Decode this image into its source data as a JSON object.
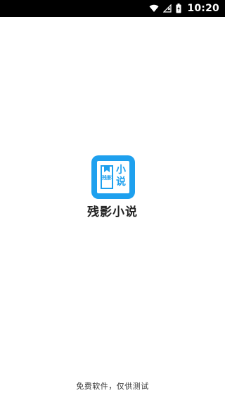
{
  "status_bar": {
    "time": "10:20",
    "icons": [
      "wifi-icon",
      "cellular-no-signal-icon",
      "battery-charging-icon"
    ]
  },
  "splash": {
    "logo_text_big": "小说",
    "logo_text_small": "残影",
    "app_name": "残影小说",
    "footer": "免费软件，仅供测试"
  },
  "colors": {
    "brand": "#1ea0ee",
    "status_bar_bg": "#000000",
    "background": "#ffffff"
  }
}
